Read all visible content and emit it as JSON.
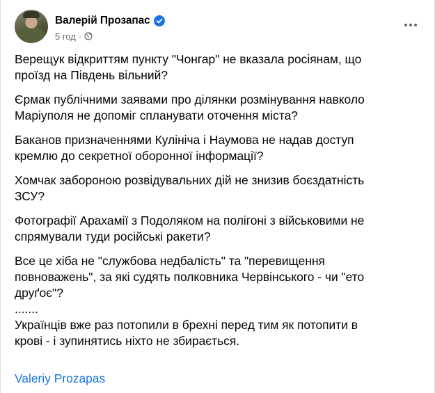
{
  "post": {
    "author": "Валерій Прозапас",
    "time": "5 год",
    "separator": "·",
    "paragraphs": [
      "Верещук відкриттям пункту \"Чонгар\" не вказала росіянам, що\nпроїзд на Південь вільний?",
      "Єрмак публічними заявами про ділянки розмінування навколо\nМаріуполя не допоміг спланувати оточення міста?",
      "Баканов призначеннями Кулініча і Наумова не надав доступ\nкремлю до секретної оборонної інформації?",
      "Хомчак забороною розвідувальних дій не знизив боєздатність\nЗСУ?",
      "Фотографії Арахамії з Подоляком на полігоні з військовими не\nспрямували туди російські ракети?",
      "Все це хіба не \"службова недбалість\" та \"перевищення\nповноважень\", за які судять полковника Червінського - чи \"ето\nдруґоє\"?",
      ".......",
      "Українців вже раз потопили в брехні перед тим як потопити в\nкрові - і зупинятись ніхто не збирається."
    ],
    "signature": "Valeriy Prozapas"
  },
  "icons": {
    "verified": "verified-badge-icon",
    "audience": "globe-icon",
    "more": "more-horizontal-icon"
  },
  "colors": {
    "accent": "#1b74e4",
    "text": "#050505",
    "secondary": "#65676b"
  }
}
